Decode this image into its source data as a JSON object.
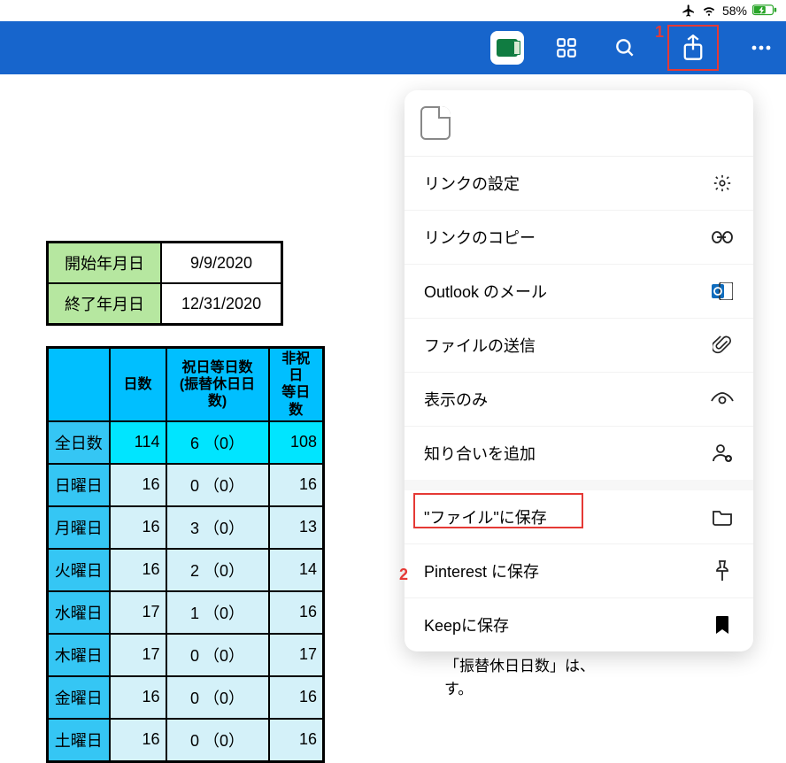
{
  "status": {
    "battery_pct": "58%"
  },
  "date_table": {
    "rows": [
      {
        "label": "開始年月日",
        "value": "9/9/2020"
      },
      {
        "label": "終了年月日",
        "value": "12/31/2020"
      }
    ]
  },
  "chart_data": {
    "type": "table",
    "columns": [
      "",
      "日数",
      "祝日等日数\n(振替休日日数)",
      "非祝日\n等日数"
    ],
    "rows": [
      {
        "label": "全日数",
        "days": 114,
        "holiday_text": "6 （0）",
        "nonholiday": 108,
        "is_sum": true
      },
      {
        "label": "日曜日",
        "days": 16,
        "holiday_text": "0 （0）",
        "nonholiday": 16
      },
      {
        "label": "月曜日",
        "days": 16,
        "holiday_text": "3 （0）",
        "nonholiday": 13
      },
      {
        "label": "火曜日",
        "days": 16,
        "holiday_text": "2 （0）",
        "nonholiday": 14
      },
      {
        "label": "水曜日",
        "days": 17,
        "holiday_text": "1 （0）",
        "nonholiday": 16
      },
      {
        "label": "木曜日",
        "days": 17,
        "holiday_text": "0 （0）",
        "nonholiday": 17
      },
      {
        "label": "金曜日",
        "days": 16,
        "holiday_text": "0 （0）",
        "nonholiday": 16
      },
      {
        "label": "土曜日",
        "days": 16,
        "holiday_text": "0 （0）",
        "nonholiday": 16
      }
    ]
  },
  "share_menu": {
    "items1": [
      {
        "label": "リンクの設定",
        "icon": "gear"
      },
      {
        "label": "リンクのコピー",
        "icon": "link"
      },
      {
        "label": "Outlook のメール",
        "icon": "outlook"
      },
      {
        "label": "ファイルの送信",
        "icon": "attach"
      },
      {
        "label": "表示のみ",
        "icon": "eye"
      },
      {
        "label": "知り合いを追加",
        "icon": "person-add"
      }
    ],
    "items2": [
      {
        "label": "\"ファイル\"に保存",
        "icon": "folder",
        "highlighted": true
      },
      {
        "label": "Pinterest に保存",
        "icon": "pin"
      },
      {
        "label": "Keepに保存",
        "icon": "bookmark"
      }
    ]
  },
  "bg_note": {
    "line1": "「振替休日日数」は、",
    "line2": "す。"
  },
  "annotations": {
    "a1": "1",
    "a2": "2"
  }
}
